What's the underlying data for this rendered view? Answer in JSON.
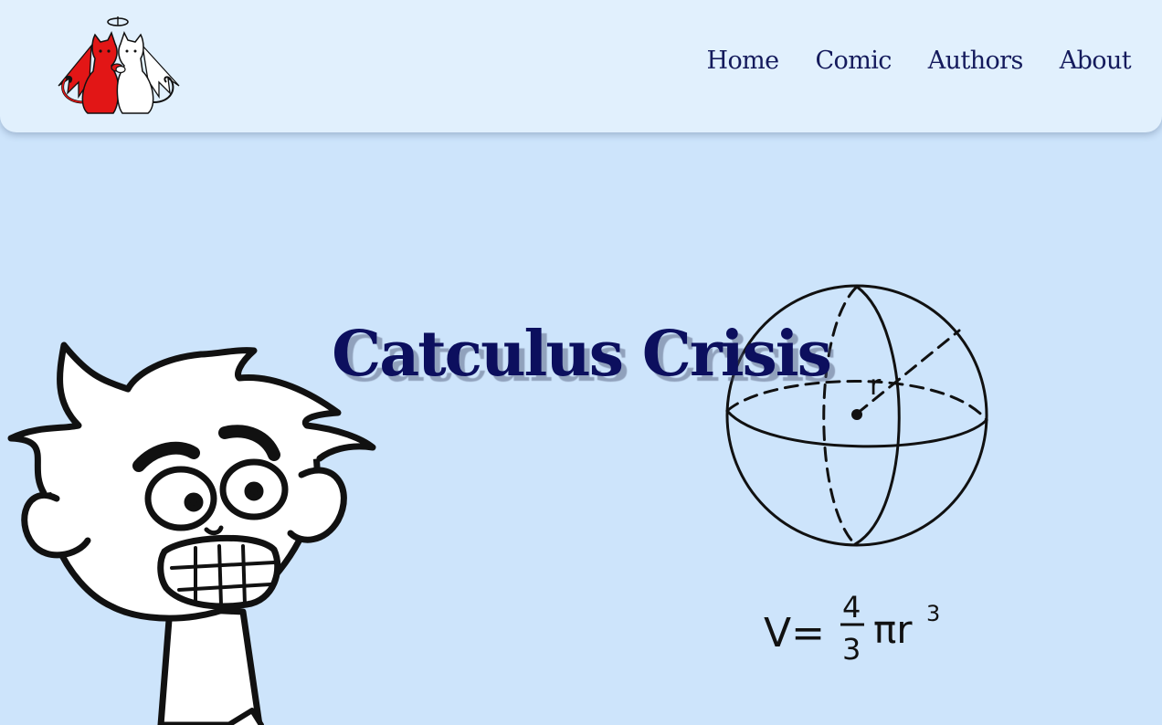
{
  "header": {
    "logo_icon": "angel-devil-cats-logo-icon",
    "nav": [
      {
        "label": "Home"
      },
      {
        "label": "Comic"
      },
      {
        "label": "Authors"
      },
      {
        "label": "About"
      }
    ]
  },
  "hero": {
    "title": "Catculus Crisis",
    "illustration_left": "panicked-boy-illustration",
    "illustration_right": "sphere-volume-diagram"
  },
  "colors": {
    "page_background": "#cde4fb",
    "header_background": "#e1f0fd",
    "nav_text": "#141a5c",
    "title_text": "#0c0f5e",
    "devil_cat": "#e21616"
  }
}
